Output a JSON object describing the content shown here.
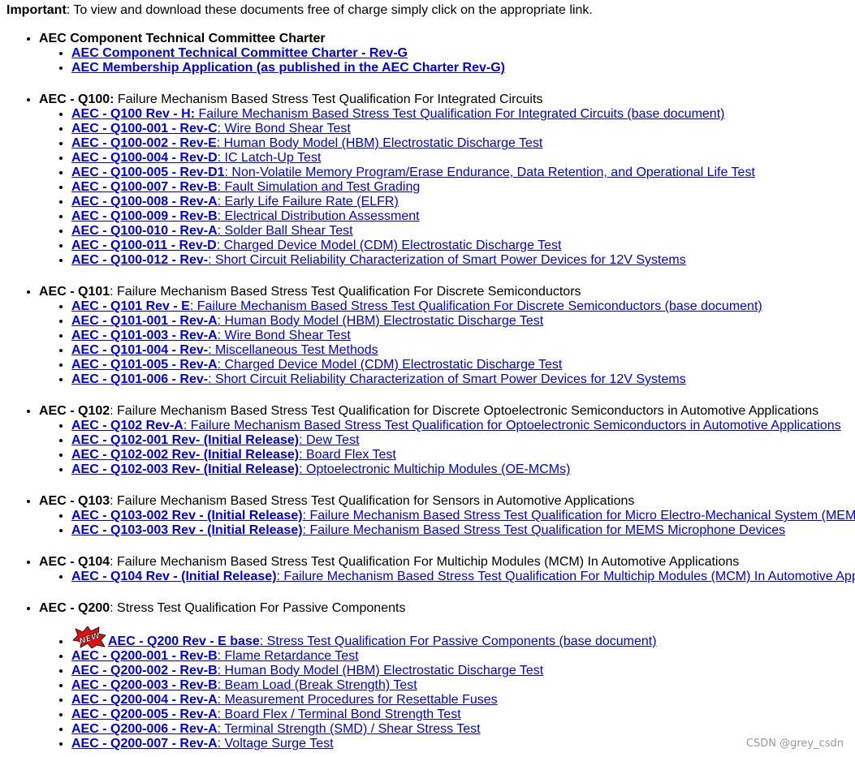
{
  "intro": {
    "bold": "Important",
    "text": ": To view and download these documents free of charge simply click on the appropriate link."
  },
  "sections": [
    {
      "code": "AEC Component Technical Committee Charter",
      "title": "",
      "docs": [
        {
          "code": "AEC Component Technical Committee Charter - Rev-G",
          "desc": ""
        },
        {
          "code": "AEC Membership Application (as published in the AEC Charter Rev-G)",
          "desc": ""
        }
      ]
    },
    {
      "code": "AEC - Q100:",
      "title": " Failure Mechanism Based Stress Test Qualification For Integrated Circuits",
      "docs": [
        {
          "code": "AEC - Q100 Rev - H:",
          "desc": " Failure Mechanism Based Stress Test Qualification For Integrated Circuits (base document)"
        },
        {
          "code": "AEC - Q100-001 - Rev-C",
          "desc": ": Wire Bond Shear Test"
        },
        {
          "code": "AEC - Q100-002 - Rev-E",
          "desc": ": Human Body Model (HBM) Electrostatic Discharge Test"
        },
        {
          "code": "AEC - Q100-004 - Rev-D",
          "desc": ": IC Latch-Up Test"
        },
        {
          "code": "AEC - Q100-005 - Rev-D1",
          "desc": ": Non-Volatile Memory Program/Erase Endurance, Data Retention, and Operational Life Test"
        },
        {
          "code": "AEC - Q100-007 - Rev-B",
          "desc": ": Fault Simulation and Test Grading"
        },
        {
          "code": "AEC - Q100-008 - Rev-A",
          "desc": ": Early Life Failure Rate (ELFR)"
        },
        {
          "code": "AEC - Q100-009 - Rev-B",
          "desc": ": Electrical Distribution Assessment"
        },
        {
          "code": "AEC - Q100-010 - Rev-A",
          "desc": ": Solder Ball Shear Test"
        },
        {
          "code": "AEC - Q100-011 - Rev-D",
          "desc": ": Charged Device Model (CDM) Electrostatic Discharge Test"
        },
        {
          "code": "AEC - Q100-012 - Rev-",
          "desc": ": Short Circuit Reliability Characterization of Smart Power Devices for 12V Systems"
        }
      ]
    },
    {
      "code": "AEC - Q101",
      "title": ": Failure Mechanism Based Stress Test Qualification For Discrete Semiconductors",
      "docs": [
        {
          "code": "AEC - Q101 Rev - E",
          "desc": ": Failure Mechanism Based Stress Test Qualification For Discrete Semiconductors (base document)"
        },
        {
          "code": "AEC - Q101-001 - Rev-A",
          "desc": ": Human Body Model (HBM) Electrostatic Discharge Test"
        },
        {
          "code": "AEC - Q101-003 - Rev-A",
          "desc": ": Wire Bond Shear Test"
        },
        {
          "code": "AEC - Q101-004 - Rev-",
          "desc": ": Miscellaneous Test Methods"
        },
        {
          "code": "AEC - Q101-005 - Rev-A",
          "desc": ": Charged Device Model (CDM) Electrostatic Discharge Test"
        },
        {
          "code": "AEC - Q101-006 - Rev-",
          "desc": ": Short Circuit Reliability Characterization of Smart Power Devices for 12V Systems"
        }
      ]
    },
    {
      "code": "AEC - Q102",
      "title": ": Failure Mechanism Based Stress Test Qualification for Discrete Optoelectronic Semiconductors in Automotive Applications",
      "docs": [
        {
          "code": "AEC - Q102 Rev-A",
          "desc": ": Failure Mechanism Based Stress Test Qualification for Optoelectronic Semiconductors in Automotive Applications"
        },
        {
          "code": "AEC - Q102-001 Rev- (Initial Release)",
          "desc": ": Dew Test"
        },
        {
          "code": "AEC - Q102-002 Rev- (Initial Release)",
          "desc": ": Board Flex Test"
        },
        {
          "code": "AEC - Q102-003 Rev- (Initial Release)",
          "desc": ": Optoelectronic Multichip Modules (OE-MCMs)"
        }
      ]
    },
    {
      "code": "AEC - Q103",
      "title": ": Failure Mechanism Based Stress Test Qualification for Sensors in Automotive Applications",
      "docs": [
        {
          "code": "AEC - Q103-002 Rev - (Initial Release)",
          "desc": ": Failure Mechanism Based Stress Test Qualification for Micro Electro-Mechanical System (MEMS"
        },
        {
          "code": "AEC - Q103-003 Rev - (Initial Release)",
          "desc": ": Failure Mechanism Based Stress Test Qualification for MEMS Microphone Devices"
        }
      ]
    },
    {
      "code": "AEC - Q104",
      "title": ": Failure Mechanism Based Stress Test Qualification For Multichip Modules (MCM) In Automotive Applications",
      "docs": [
        {
          "code": "AEC - Q104 Rev - (Initial Release)",
          "desc": ": Failure Mechanism Based Stress Test Qualification For Multichip Modules (MCM) In Automotive App"
        }
      ]
    },
    {
      "code": "AEC - Q200",
      "title": ": Stress Test Qualification For Passive Components",
      "docs": [
        {
          "code": "AEC - Q200 Rev - E base",
          "desc": ": Stress Test Qualification For Passive Components (base document)",
          "new": true
        },
        {
          "code": "AEC - Q200-001 - Rev-B",
          "desc": ": Flame Retardance Test"
        },
        {
          "code": "AEC - Q200-002 - Rev-B",
          "desc": ": Human Body Model (HBM) Electrostatic Discharge Test"
        },
        {
          "code": "AEC - Q200-003 - Rev-B",
          "desc": ": Beam Load (Break Strength) Test"
        },
        {
          "code": "AEC - Q200-004 - Rev-A",
          "desc": ": Measurement Procedures for Resettable Fuses"
        },
        {
          "code": "AEC - Q200-005 - Rev-A",
          "desc": ": Board Flex / Terminal Bond Strength Test"
        },
        {
          "code": "AEC - Q200-006 - Rev-A",
          "desc": ": Terminal Strength (SMD) / Shear Stress Test"
        },
        {
          "code": "AEC - Q200-007 - Rev-A",
          "desc": ": Voltage Surge Test"
        }
      ]
    }
  ],
  "new_badge": {
    "label": "NEW"
  },
  "watermark": "CSDN @grey_csdn",
  "colors": {
    "link": "#0000ee",
    "badge_red": "#e01010",
    "watermark": "#9a9a9a"
  }
}
